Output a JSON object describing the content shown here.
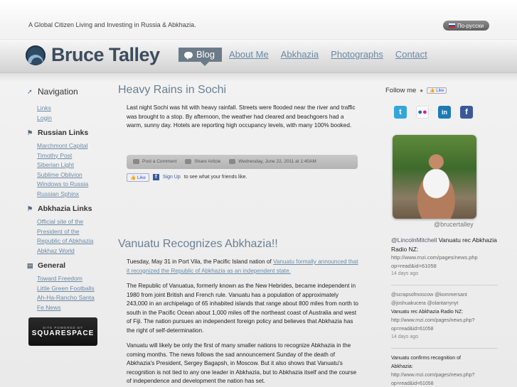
{
  "top": {
    "tagline": "A Global Citizen Living and Investing in Russia & Abkhazia.",
    "lang_button": "По-русски"
  },
  "header": {
    "site_title": "Bruce Talley",
    "nav": [
      "Blog",
      "About Me",
      "Abkhazia",
      "Photographs",
      "Contact"
    ]
  },
  "sidebar": {
    "navigation": {
      "title": "Navigation",
      "links": [
        "Links",
        "Login"
      ]
    },
    "russian": {
      "title": "Russian Links",
      "links": [
        "Marchmont Capital",
        "Timothy Post",
        "Siberian Light",
        "Sublime Oblivion",
        "Windows to Russia",
        "Russian Sphinx"
      ]
    },
    "abkhazia": {
      "title": "Abkhazia Links",
      "links": [
        "Official site of the",
        "President of the",
        "Republic of Abkhazia",
        "Abkhaz World"
      ]
    },
    "general": {
      "title": "General",
      "links": [
        "Toward Freedom",
        "Little Green Footballs",
        "Ah-Ha-Rancho Santa",
        "Fe News"
      ]
    },
    "badge_small": "SITE POWERED BY",
    "badge_big": "SQUARESPACE"
  },
  "post1": {
    "title": "Heavy Rains in Sochi",
    "body": "Last night Sochi was hit with heavy rainfall.  Streets were flooded near the river and traffic was brought to a stop.  By afternoon, the weather had cleared and beachgoers had a warm, sunny day.  Hotels are reporting high occupancy levels, with many 100% booked.",
    "meta": {
      "comment": "Post a Comment",
      "share": "Share Article",
      "date": "Wednesday, June 22, 2011 at 1:40AM"
    },
    "like": {
      "button": "Like",
      "signup": "Sign Up",
      "rest": "to see what your friends like."
    }
  },
  "post2": {
    "title": "Vanuatu Recognizes Abkhazia!!",
    "lead_prefix": "Tuesday, May 31 in Port Vila, the Pacific Island nation of ",
    "lead_link": "Vanuatu formally announced that it recognized the Republic of Abkhazia as an independent state.",
    "para2": "The Republic of Vanuatua, formerly known as the New Hebrides, became independent in 1980 from joint British and French rule.  Vanuatu has a population of approximately 243,000 in an archipelago of 65 inhabited islands that range about 800 miles from north to south in the Pacific Ocean about 1,000 miles off the northeast coast of Australia and west of Fiji.  The nation pursues an independent foreign policy and believes that Abkhazia has the right of self-determination.",
    "para3": "Vanuatu will likely be only the first of many smaller nations to recognize Abkhazia in the coming months.  The news follows the sad announcement Sunday of the death of Abkhazia's President, Sergey Bagapsh, in Moscow. But it also shows that Vanuatu's recognition is not tied to any one leader in Abkhazia, but to Abkhazia itself and the course of independence and development the nation has set."
  },
  "right": {
    "follow_label": "Follow me",
    "follow_like": "Like",
    "social": [
      {
        "icon": "twitter-icon",
        "glyph": "t",
        "color": "#35a6d9"
      },
      {
        "icon": "flickr-icon",
        "glyph": "••",
        "color": "#ffffff"
      },
      {
        "icon": "linkedin-icon",
        "glyph": "in",
        "color": "#1c7ab5"
      },
      {
        "icon": "facebook-icon",
        "glyph": "f",
        "color": "#3b5998"
      }
    ],
    "handle": "@brucertalley",
    "tweet1": {
      "at": "@LincolnMitchell",
      "text": "Vanuatu rec Abkhazia Radio NZ:",
      "url1": "http://www.rnzi.com/pages/news.php",
      "url2": "op=read&id=61058",
      "time": "14 days ago"
    },
    "tweet2": {
      "at1": "@scrapsofmoscow",
      "at2": "@kommersant",
      "at3": "@joshuakucera",
      "at4": "@olantarrynyt",
      "text": "Vanuatu rec Abkhazia Radio NZ:",
      "url1": "http://www.rnzi.com/pages/news.php?",
      "url2": "op=read&id=61058",
      "time": "14 days ago"
    },
    "tweet3": {
      "text1": "Vanuatu confirms recognition of",
      "text2": "Abkhazia:",
      "url1": "http://www.rnzi.com/pages/news.php?",
      "url2": "op=read&id=61058"
    }
  }
}
